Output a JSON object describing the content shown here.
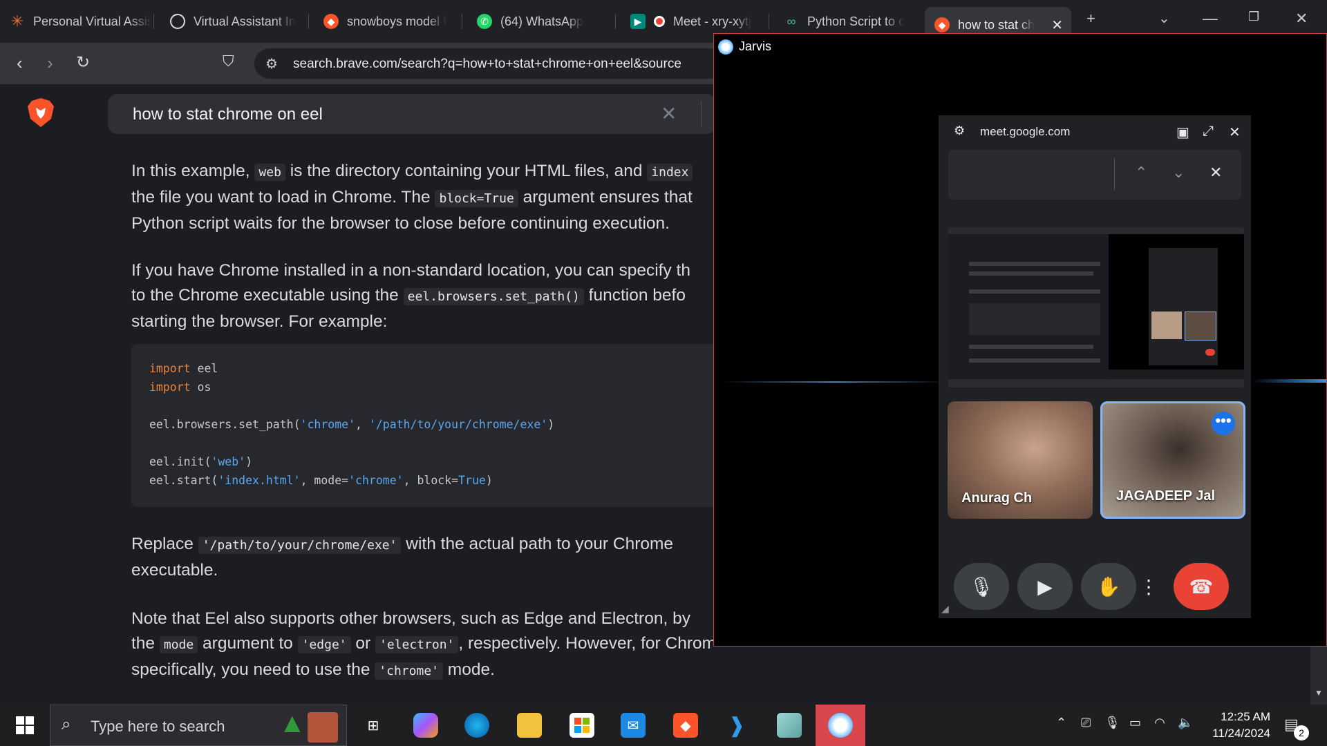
{
  "tabs": [
    {
      "label": "Personal Virtual Assistant",
      "icon": "asterisk-icon"
    },
    {
      "label": "Virtual Assistant In",
      "icon": "chatgpt-icon"
    },
    {
      "label": "snowboys model f",
      "icon": "brave-icon"
    },
    {
      "label": "(64) WhatsApp",
      "icon": "whatsapp-icon"
    },
    {
      "label": "Meet - xry-xytj",
      "icon": "meet-icon"
    },
    {
      "label": "Python Script to c",
      "icon": "link-icon"
    },
    {
      "label": "how to stat ch",
      "icon": "brave-icon",
      "active": true
    }
  ],
  "browser": {
    "url": "search.brave.com/search?q=how+to+stat+chrome+on+eel&source"
  },
  "search": {
    "query": "how to stat chrome on eel"
  },
  "article": {
    "p1_a": "In this example, ",
    "p1_code1": "web",
    "p1_b": " is the directory containing your HTML files, and ",
    "p1_code2": "index",
    "p1_c": "the file you want to load in Chrome. The ",
    "p1_code3": "block=True",
    "p1_d": " argument ensures that",
    "p1_e": "Python script waits for the browser to close before continuing execution.",
    "p2_a": "If you have Chrome installed in a non-standard location, you can specify th",
    "p2_b": "to the Chrome executable using the ",
    "p2_code": "eel.browsers.set_path()",
    "p2_c": " function befo",
    "p2_d": "starting the browser. For example:",
    "code": {
      "l1_kw": "import",
      "l1": " eel",
      "l2_kw": "import",
      "l2": " os",
      "l3_a": "eel.browsers.set_path(",
      "l3_s1": "'chrome'",
      "l3_b": ", ",
      "l3_s2": "'/path/to/your/chrome/exe'",
      "l3_c": ")",
      "l4_a": "eel.init(",
      "l4_s": "'web'",
      "l4_b": ")",
      "l5_a": "eel.start(",
      "l5_s1": "'index.html'",
      "l5_b": ", mode=",
      "l5_s2": "'chrome'",
      "l5_c": ", block=",
      "l5_s3": "True",
      "l5_d": ")"
    },
    "p3_a": "Replace ",
    "p3_code": "'/path/to/your/chrome/exe'",
    "p3_b": " with the actual path to your Chrome",
    "p3_c": "executable.",
    "p4_a": "Note that Eel also supports other browsers, such as Edge and Electron, by",
    "p4_b": "the ",
    "p4_code1": "mode",
    "p4_c": " argument to ",
    "p4_code2": "'edge'",
    "p4_d": " or ",
    "p4_code3": "'electron'",
    "p4_e": ", respectively. However, for Chrome",
    "p4_f": "specifically, you need to use the ",
    "p4_code4": "'chrome'",
    "p4_g": " mode."
  },
  "jarvis": {
    "title": "Jarvis"
  },
  "meet": {
    "url": "meet.google.com",
    "participants": [
      {
        "name": "Anurag Ch"
      },
      {
        "name": "JAGADEEP Jal"
      }
    ]
  },
  "taskbar": {
    "search_placeholder": "Type here to search",
    "time": "12:25 AM",
    "date": "11/24/2024",
    "notification_count": "2"
  },
  "colors": {
    "accent_blue": "#5aa7ef",
    "keyword_orange": "#f0823c",
    "end_call_red": "#ea4335",
    "jarvis_border": "#d53a3a"
  }
}
